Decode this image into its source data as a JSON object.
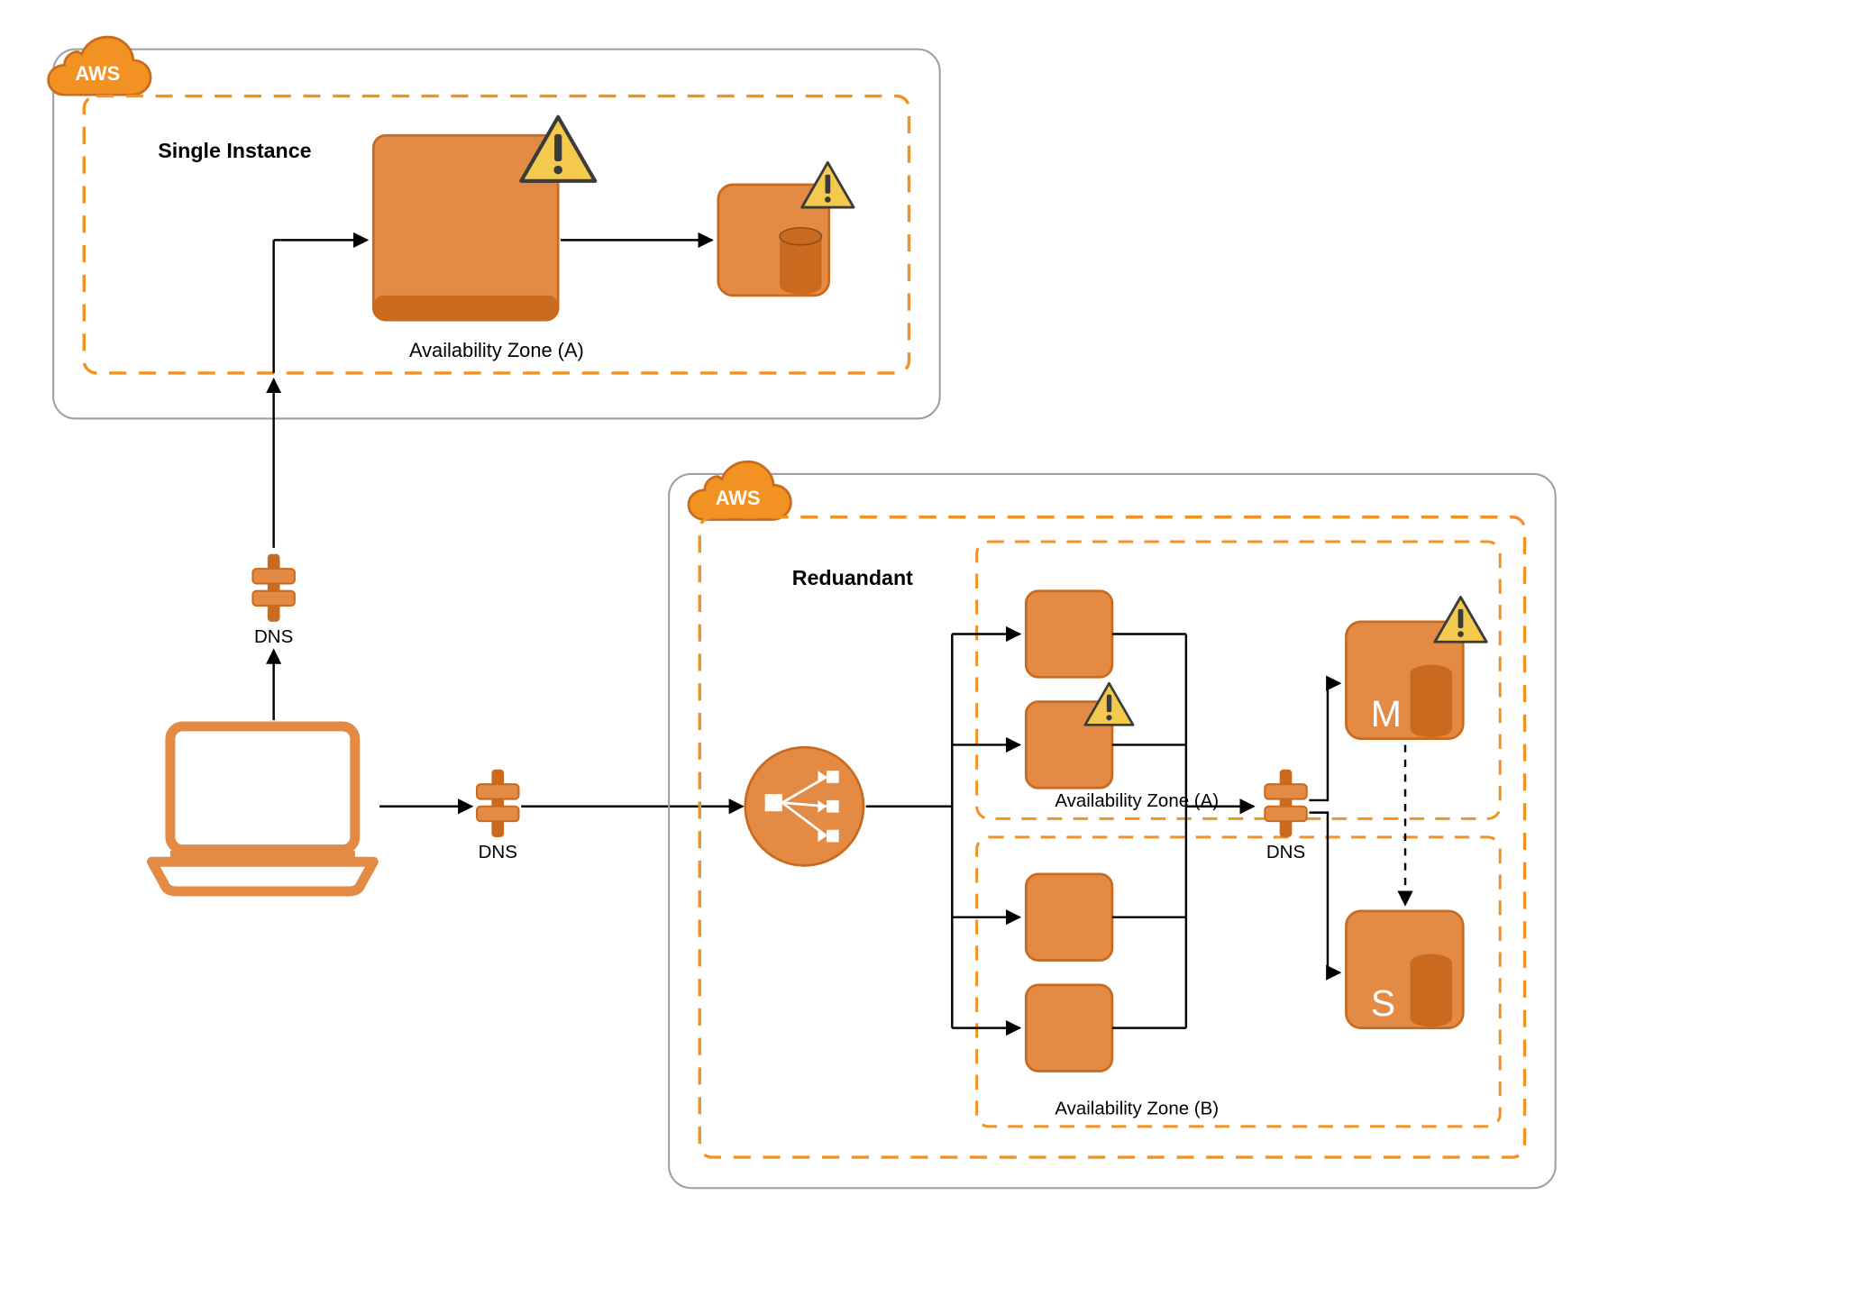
{
  "colors": {
    "orange_fill": "#E38B45",
    "orange_stroke": "#C96A1F",
    "orange_bright": "#F29222",
    "dash": "#F29222",
    "text": "#000000",
    "warn_fill": "#F3C94E",
    "warn_stroke": "#3B3B3B",
    "gray_stroke": "#9AA0A6"
  },
  "labels": {
    "aws_top": "AWS",
    "aws_bottom": "AWS",
    "single_title": "Single Instance",
    "redundant_title": "Reduandant",
    "az_a_top": "Availability Zone (A)",
    "az_a_mid": "Availability Zone (A)",
    "az_b": "Availability Zone (B)",
    "dns1": "DNS",
    "dns2": "DNS",
    "dns3": "DNS",
    "db_master_tag": "M",
    "db_slave_tag": "S"
  }
}
